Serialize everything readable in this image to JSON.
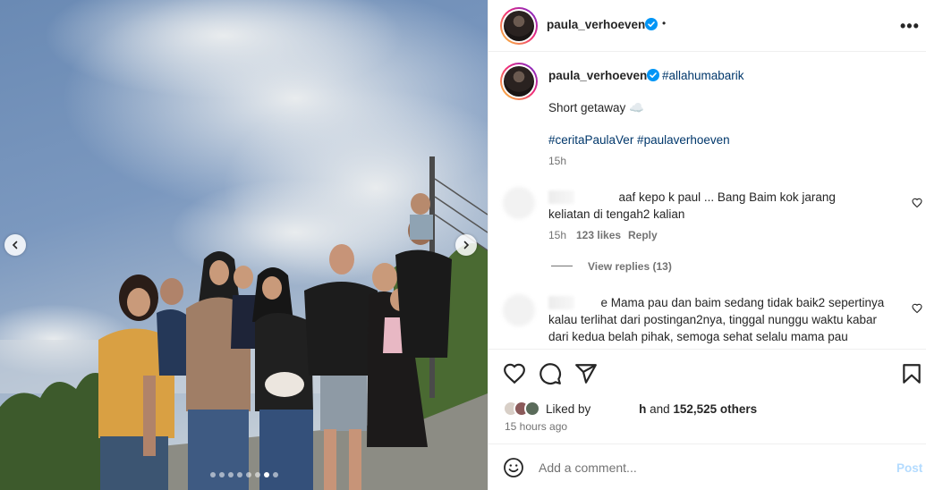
{
  "post": {
    "username": "paula_verhoeven",
    "header_dot": "•",
    "more_label": "•••",
    "caption_hashtag": "#allahumabarik",
    "caption_text": "Short getaway ☁️",
    "caption_hashtags_line": "#ceritaPaulaVer #paulaverhoeven",
    "caption_time": "15h"
  },
  "comments": [
    {
      "username": "user",
      "text_line1": "aaf kepo k paul ... Bang Baim kok jarang",
      "text_line2": "keliatan di tengah2 kalian",
      "time": "15h",
      "likes": "123 likes",
      "reply_label": "Reply",
      "view_replies": "View replies (13)"
    },
    {
      "username": "user",
      "text_line1": "e Mama pau dan baim sedang tidak baik2 sepertinya",
      "text_line2": "kalau terlihat dari postingan2nya, tinggal nunggu waktu kabar",
      "text_line3": "dari kedua belah pihak, semoga sehat selalu mama pau"
    }
  ],
  "likes": {
    "prefix": "Liked by",
    "liker": "h",
    "connector": "and",
    "others": "152,525 others",
    "time_ago": "15 hours ago"
  },
  "comment_box": {
    "placeholder": "Add a comment...",
    "post_label": "Post"
  },
  "carousel": {
    "total_slides": 8,
    "active_slide": 6
  },
  "colors": {
    "link": "#00376b",
    "verified": "#0095f6",
    "post_disabled": "#b3dbff",
    "secondary_text": "#737373"
  },
  "icons": [
    "chevron-left-icon",
    "chevron-right-icon",
    "verified-icon",
    "more-icon",
    "heart-icon",
    "comment-icon",
    "share-icon",
    "bookmark-icon",
    "emoji-icon"
  ]
}
